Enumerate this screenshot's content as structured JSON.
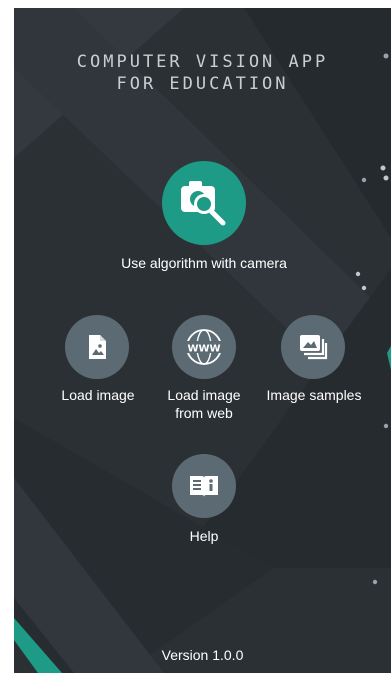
{
  "app": {
    "title_line1": "COMPUTER VISION APP",
    "title_line2": "FOR EDUCATION"
  },
  "menu": {
    "camera": {
      "label": "Use algorithm with camera",
      "icon": "camera-search-icon"
    },
    "load_image": {
      "label": "Load image",
      "icon": "image-file-icon"
    },
    "load_web": {
      "label_line1": "Load image",
      "label_line2": "from web",
      "icon": "www-globe-icon"
    },
    "samples": {
      "label": "Image samples",
      "icon": "image-stack-icon"
    },
    "help": {
      "label": "Help",
      "icon": "book-info-icon"
    }
  },
  "footer": {
    "version": "Version 1.0.0"
  },
  "colors": {
    "background": "#2b3035",
    "accent": "#1e9b86",
    "secondary_button": "#5c6b73",
    "text": "#ffffff"
  }
}
